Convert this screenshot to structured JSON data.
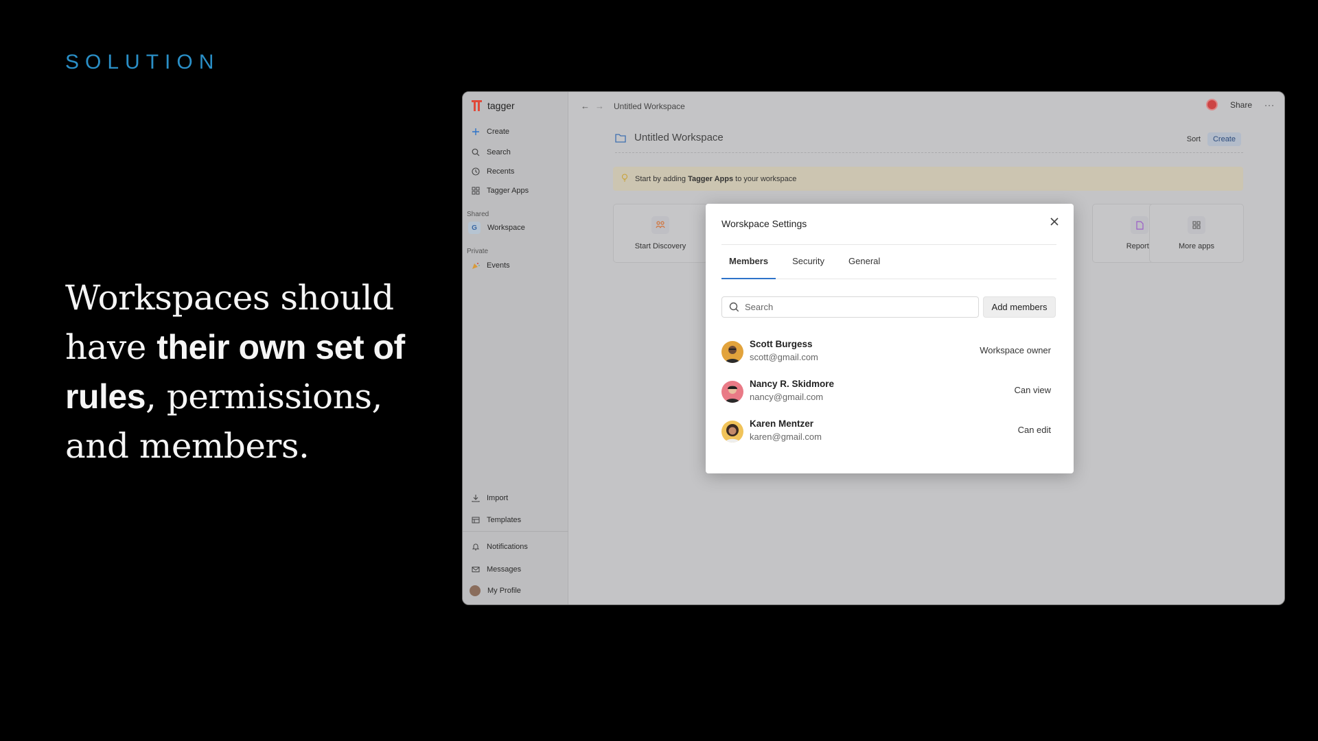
{
  "slide": {
    "eyebrow": "SOLUTION",
    "headline_part1": "Workspaces should have ",
    "headline_bold": "their own set of rules",
    "headline_part2": ", permissions, and members."
  },
  "app": {
    "brand": "tagger",
    "sidebar": {
      "create": "Create",
      "search": "Search",
      "recents": "Recents",
      "apps": "Tagger Apps",
      "shared_label": "Shared",
      "workspace_badge": "G",
      "workspace": "Workspace",
      "private_label": "Private",
      "events": "Events",
      "import": "Import",
      "templates": "Templates",
      "notifications": "Notifications",
      "messages": "Messages",
      "profile": "My Profile"
    },
    "topbar": {
      "breadcrumb": "Untitled Workspace",
      "share": "Share"
    },
    "workspace": {
      "title": "Untitled Workspace",
      "sort": "Sort",
      "create": "Create",
      "banner_prefix": "Start by adding ",
      "banner_bold": "Tagger Apps",
      "banner_suffix": " to your workspace"
    },
    "cards": {
      "discovery": "Start Discovery",
      "reports": "Reports",
      "more": "More apps"
    }
  },
  "modal": {
    "title": "Worskpace Settings",
    "tabs": [
      "Members",
      "Security",
      "General"
    ],
    "search_placeholder": "Search",
    "add_members": "Add members",
    "members": [
      {
        "name": "Scott Burgess",
        "email": "scott@gmail.com",
        "role": "Workspace owner"
      },
      {
        "name": "Nancy R. Skidmore",
        "email": "nancy@gmail.com",
        "role": "Can view"
      },
      {
        "name": "Karen Mentzer",
        "email": "karen@gmail.com",
        "role": "Can edit"
      }
    ]
  },
  "colors": {
    "accent": "#2d73c9",
    "eyebrow": "#2a8fc7",
    "brand": "#e04a3a"
  }
}
